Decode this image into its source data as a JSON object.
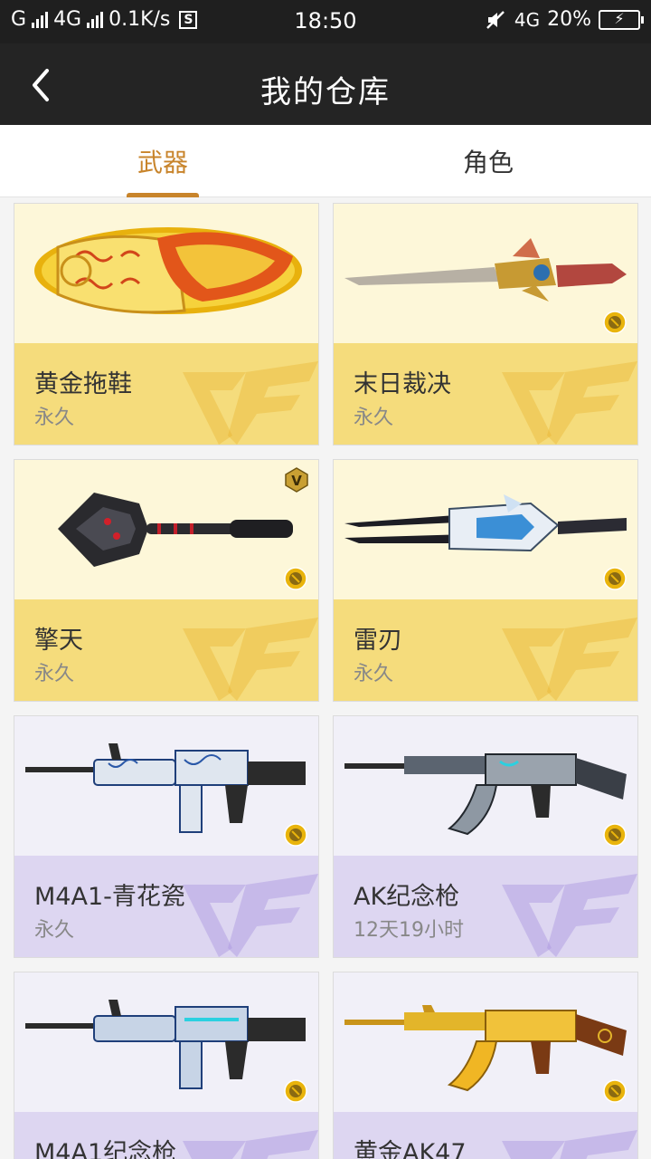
{
  "status_bar": {
    "carrier1": "G",
    "carrier2": "4G",
    "speed": "0.1K/s",
    "time": "18:50",
    "network": "4G",
    "battery": "20%"
  },
  "header": {
    "title": "我的仓库"
  },
  "tabs": [
    {
      "label": "武器",
      "active": true
    },
    {
      "label": "角色",
      "active": false
    }
  ],
  "items": [
    {
      "name": "黄金拖鞋",
      "duration": "永久",
      "theme": "gold",
      "icon": "golden-slipper"
    },
    {
      "name": "末日裁决",
      "duration": "永久",
      "theme": "gold",
      "icon": "sword"
    },
    {
      "name": "擎天",
      "duration": "永久",
      "theme": "gold",
      "icon": "shovel"
    },
    {
      "name": "雷刃",
      "duration": "永久",
      "theme": "gold",
      "icon": "blade"
    },
    {
      "name": "M4A1-青花瓷",
      "duration": "永久",
      "theme": "purple",
      "icon": "rifle-m4a1"
    },
    {
      "name": "AK纪念枪",
      "duration": "12天19小时",
      "theme": "purple",
      "icon": "rifle-ak"
    },
    {
      "name": "M4A1纪念枪",
      "duration": "",
      "theme": "purple",
      "icon": "rifle-m4a1"
    },
    {
      "name": "黄金AK47",
      "duration": "",
      "theme": "purple",
      "icon": "rifle-ak-gold"
    }
  ],
  "colors": {
    "accent": "#c8842b",
    "gold_card": "#f5dc7c",
    "purple_card": "#ddd6f1"
  }
}
